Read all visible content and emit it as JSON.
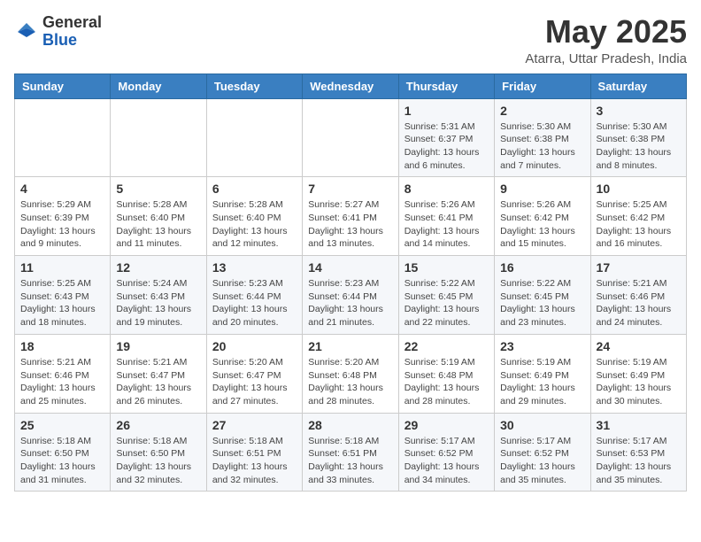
{
  "header": {
    "logo_line1": "General",
    "logo_line2": "Blue",
    "month": "May 2025",
    "location": "Atarra, Uttar Pradesh, India"
  },
  "days_of_week": [
    "Sunday",
    "Monday",
    "Tuesday",
    "Wednesday",
    "Thursday",
    "Friday",
    "Saturday"
  ],
  "weeks": [
    [
      {
        "day": "",
        "info": ""
      },
      {
        "day": "",
        "info": ""
      },
      {
        "day": "",
        "info": ""
      },
      {
        "day": "",
        "info": ""
      },
      {
        "day": "1",
        "info": "Sunrise: 5:31 AM\nSunset: 6:37 PM\nDaylight: 13 hours\nand 6 minutes."
      },
      {
        "day": "2",
        "info": "Sunrise: 5:30 AM\nSunset: 6:38 PM\nDaylight: 13 hours\nand 7 minutes."
      },
      {
        "day": "3",
        "info": "Sunrise: 5:30 AM\nSunset: 6:38 PM\nDaylight: 13 hours\nand 8 minutes."
      }
    ],
    [
      {
        "day": "4",
        "info": "Sunrise: 5:29 AM\nSunset: 6:39 PM\nDaylight: 13 hours\nand 9 minutes."
      },
      {
        "day": "5",
        "info": "Sunrise: 5:28 AM\nSunset: 6:40 PM\nDaylight: 13 hours\nand 11 minutes."
      },
      {
        "day": "6",
        "info": "Sunrise: 5:28 AM\nSunset: 6:40 PM\nDaylight: 13 hours\nand 12 minutes."
      },
      {
        "day": "7",
        "info": "Sunrise: 5:27 AM\nSunset: 6:41 PM\nDaylight: 13 hours\nand 13 minutes."
      },
      {
        "day": "8",
        "info": "Sunrise: 5:26 AM\nSunset: 6:41 PM\nDaylight: 13 hours\nand 14 minutes."
      },
      {
        "day": "9",
        "info": "Sunrise: 5:26 AM\nSunset: 6:42 PM\nDaylight: 13 hours\nand 15 minutes."
      },
      {
        "day": "10",
        "info": "Sunrise: 5:25 AM\nSunset: 6:42 PM\nDaylight: 13 hours\nand 16 minutes."
      }
    ],
    [
      {
        "day": "11",
        "info": "Sunrise: 5:25 AM\nSunset: 6:43 PM\nDaylight: 13 hours\nand 18 minutes."
      },
      {
        "day": "12",
        "info": "Sunrise: 5:24 AM\nSunset: 6:43 PM\nDaylight: 13 hours\nand 19 minutes."
      },
      {
        "day": "13",
        "info": "Sunrise: 5:23 AM\nSunset: 6:44 PM\nDaylight: 13 hours\nand 20 minutes."
      },
      {
        "day": "14",
        "info": "Sunrise: 5:23 AM\nSunset: 6:44 PM\nDaylight: 13 hours\nand 21 minutes."
      },
      {
        "day": "15",
        "info": "Sunrise: 5:22 AM\nSunset: 6:45 PM\nDaylight: 13 hours\nand 22 minutes."
      },
      {
        "day": "16",
        "info": "Sunrise: 5:22 AM\nSunset: 6:45 PM\nDaylight: 13 hours\nand 23 minutes."
      },
      {
        "day": "17",
        "info": "Sunrise: 5:21 AM\nSunset: 6:46 PM\nDaylight: 13 hours\nand 24 minutes."
      }
    ],
    [
      {
        "day": "18",
        "info": "Sunrise: 5:21 AM\nSunset: 6:46 PM\nDaylight: 13 hours\nand 25 minutes."
      },
      {
        "day": "19",
        "info": "Sunrise: 5:21 AM\nSunset: 6:47 PM\nDaylight: 13 hours\nand 26 minutes."
      },
      {
        "day": "20",
        "info": "Sunrise: 5:20 AM\nSunset: 6:47 PM\nDaylight: 13 hours\nand 27 minutes."
      },
      {
        "day": "21",
        "info": "Sunrise: 5:20 AM\nSunset: 6:48 PM\nDaylight: 13 hours\nand 28 minutes."
      },
      {
        "day": "22",
        "info": "Sunrise: 5:19 AM\nSunset: 6:48 PM\nDaylight: 13 hours\nand 28 minutes."
      },
      {
        "day": "23",
        "info": "Sunrise: 5:19 AM\nSunset: 6:49 PM\nDaylight: 13 hours\nand 29 minutes."
      },
      {
        "day": "24",
        "info": "Sunrise: 5:19 AM\nSunset: 6:49 PM\nDaylight: 13 hours\nand 30 minutes."
      }
    ],
    [
      {
        "day": "25",
        "info": "Sunrise: 5:18 AM\nSunset: 6:50 PM\nDaylight: 13 hours\nand 31 minutes."
      },
      {
        "day": "26",
        "info": "Sunrise: 5:18 AM\nSunset: 6:50 PM\nDaylight: 13 hours\nand 32 minutes."
      },
      {
        "day": "27",
        "info": "Sunrise: 5:18 AM\nSunset: 6:51 PM\nDaylight: 13 hours\nand 32 minutes."
      },
      {
        "day": "28",
        "info": "Sunrise: 5:18 AM\nSunset: 6:51 PM\nDaylight: 13 hours\nand 33 minutes."
      },
      {
        "day": "29",
        "info": "Sunrise: 5:17 AM\nSunset: 6:52 PM\nDaylight: 13 hours\nand 34 minutes."
      },
      {
        "day": "30",
        "info": "Sunrise: 5:17 AM\nSunset: 6:52 PM\nDaylight: 13 hours\nand 35 minutes."
      },
      {
        "day": "31",
        "info": "Sunrise: 5:17 AM\nSunset: 6:53 PM\nDaylight: 13 hours\nand 35 minutes."
      }
    ]
  ]
}
